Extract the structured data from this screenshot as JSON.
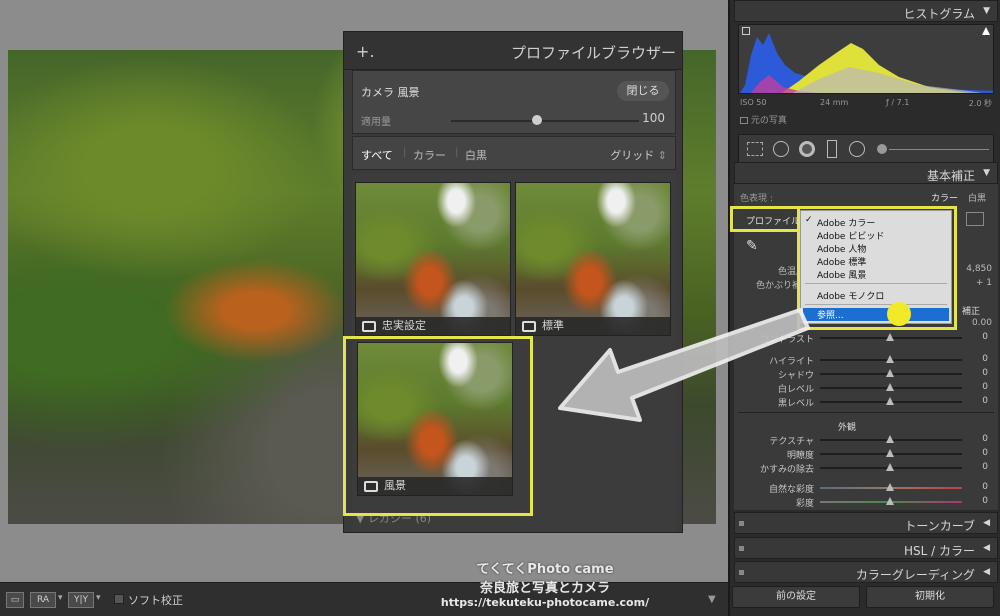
{
  "profile_browser": {
    "title": "プロファイルブラウザー",
    "plus": "+.",
    "current_profile": "カメラ 風景",
    "close_label": "閉じる",
    "amount_label": "適用量",
    "amount_value": "100",
    "amount_fraction": 0.5,
    "filters": [
      "すべて",
      "カラー",
      "白黒"
    ],
    "view_mode": "グリッド",
    "thumbnails": [
      {
        "label": "忠実設定"
      },
      {
        "label": "標準"
      },
      {
        "label": "風景"
      }
    ],
    "legacy_group": "レガシー (6)"
  },
  "right_panel": {
    "histogram_title": "ヒストグラム",
    "meta": {
      "iso": "ISO 50",
      "focal": "24 mm",
      "aperture": "ƒ / 7.1",
      "shutter": "2.0 秒"
    },
    "original_photo": "元の写真",
    "basic_title": "基本補正",
    "treatment_label": "色表現 :",
    "treatment_color": "カラー",
    "treatment_bw": "白黒",
    "profile_label": "プロファイル",
    "wb_temp_label": "色温度",
    "wb_temp_value": "4,850",
    "wb_tint_label": "色かぶり補正",
    "wb_tint_value": "+ 1",
    "tone_head": "補正",
    "exposure_value": "0.00",
    "tone_sliders": [
      {
        "label": "コントラスト",
        "value": "0"
      },
      {
        "label": "ハイライト",
        "value": "0"
      },
      {
        "label": "シャドウ",
        "value": "0"
      },
      {
        "label": "白レベル",
        "value": "0"
      },
      {
        "label": "黒レベル",
        "value": "0"
      }
    ],
    "presence_title": "外観",
    "presence_sliders": [
      {
        "label": "テクスチャ",
        "value": "0"
      },
      {
        "label": "明瞭度",
        "value": "0"
      },
      {
        "label": "かすみの除去",
        "value": "0"
      },
      {
        "label": "自然な彩度",
        "value": "0"
      },
      {
        "label": "彩度",
        "value": "0"
      }
    ],
    "sections": [
      "トーンカーブ",
      "HSL / カラー",
      "カラーグレーディング"
    ],
    "prev_button": "前の設定",
    "reset_button": "初期化"
  },
  "profile_menu": {
    "items": [
      "Adobe カラー",
      "Adobe ビビッド",
      "Adobe 人物",
      "Adobe 標準",
      "Adobe 風景"
    ],
    "checked_index": 0,
    "mono": "Adobe モノクロ",
    "browse": "参照..."
  },
  "toolbar": {
    "soft_proof": "ソフト校正",
    "btn_ra": "RA",
    "btn_yy": "Y|Y"
  },
  "watermark": {
    "line1": "てくてくPhoto came",
    "line2": "奈良旅と写真とカメラ",
    "line3": "https://tekuteku-photocame.com/"
  },
  "colors": {
    "highlight": "#e3e54b",
    "menu_selected": "#1b6fd1",
    "yellow_dot": "#f2ea27"
  }
}
